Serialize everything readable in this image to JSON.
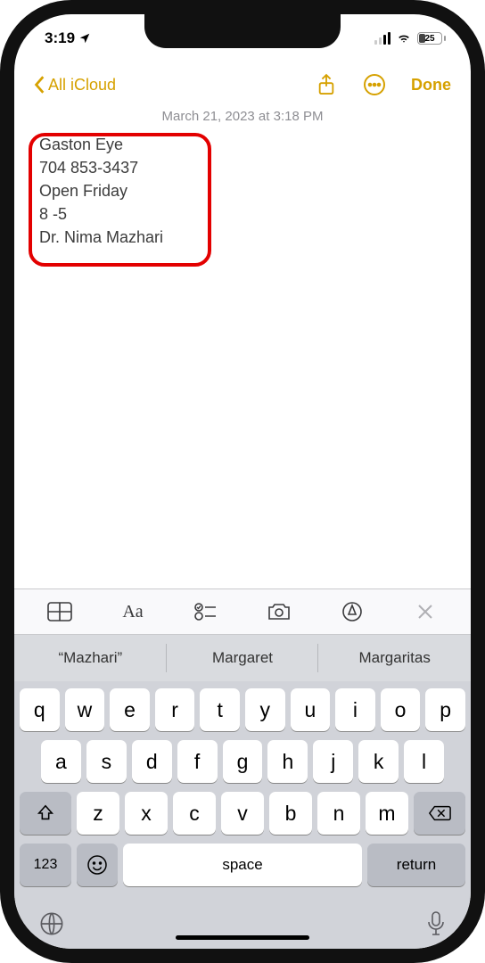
{
  "status": {
    "time": "3:19",
    "battery_pct": "25"
  },
  "nav": {
    "back_label": "All iCloud",
    "done_label": "Done"
  },
  "note": {
    "meta": "March 21, 2023 at 3:18 PM",
    "lines": [
      "Gaston Eye",
      "704 853-3437",
      "Open Friday",
      "8 -5",
      "Dr. Nima Mazhari"
    ]
  },
  "suggestions": [
    "“Mazhari”",
    "Margaret",
    "Margaritas"
  ],
  "keyboard": {
    "row1": [
      "q",
      "w",
      "e",
      "r",
      "t",
      "y",
      "u",
      "i",
      "o",
      "p"
    ],
    "row2": [
      "a",
      "s",
      "d",
      "f",
      "g",
      "h",
      "j",
      "k",
      "l"
    ],
    "row3": [
      "z",
      "x",
      "c",
      "v",
      "b",
      "n",
      "m"
    ],
    "num": "123",
    "space": "space",
    "ret": "return"
  }
}
